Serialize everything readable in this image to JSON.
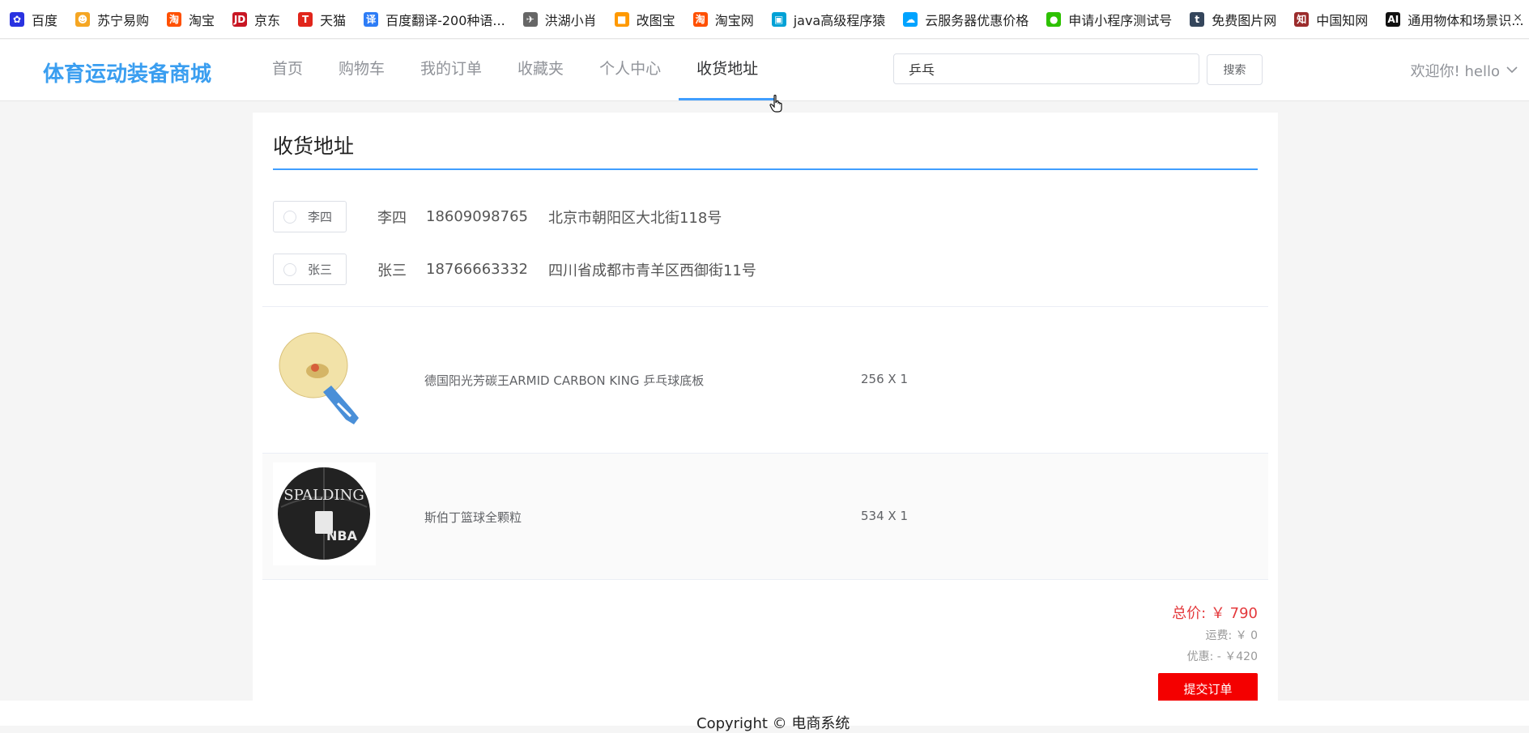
{
  "bookmarks": [
    {
      "label": "百度",
      "icon": "baidu-paw-icon",
      "color": "#2932e1",
      "glyph": "✿"
    },
    {
      "label": "苏宁易购",
      "icon": "suning-icon",
      "color": "#f5a623",
      "glyph": "☻"
    },
    {
      "label": "淘宝",
      "icon": "taobao-icon",
      "color": "#ff5000",
      "glyph": "淘"
    },
    {
      "label": "京东",
      "icon": "jd-icon",
      "color": "#c81623",
      "glyph": "JD"
    },
    {
      "label": "天猫",
      "icon": "tmall-icon",
      "color": "#e1251b",
      "glyph": "T"
    },
    {
      "label": "百度翻译-200种语...",
      "icon": "baidu-translate-icon",
      "color": "#2d7cf6",
      "glyph": "译"
    },
    {
      "label": "洪湖小肖",
      "icon": "bird-icon",
      "color": "#666666",
      "glyph": "✈"
    },
    {
      "label": "改图宝",
      "icon": "gaitubao-icon",
      "color": "#ff9900",
      "glyph": "■"
    },
    {
      "label": "淘宝网",
      "icon": "taobao-net-icon",
      "color": "#ff5000",
      "glyph": "淘"
    },
    {
      "label": "java高级程序猿",
      "icon": "bilibili-icon",
      "color": "#00a1d6",
      "glyph": "▣"
    },
    {
      "label": "云服务器优惠价格",
      "icon": "cloud-icon",
      "color": "#00a3ff",
      "glyph": "☁"
    },
    {
      "label": "申请小程序测试号",
      "icon": "wechat-icon",
      "color": "#2dc100",
      "glyph": "●"
    },
    {
      "label": "免费图片网",
      "icon": "tumblr-icon",
      "color": "#35465c",
      "glyph": "t"
    },
    {
      "label": "中国知网",
      "icon": "cnki-icon",
      "color": "#9b2c2c",
      "glyph": "知"
    },
    {
      "label": "通用物体和场景识...",
      "icon": "ai-icon",
      "color": "#111111",
      "glyph": "AI"
    }
  ],
  "header": {
    "logo": "体育运动装备商城",
    "nav": [
      {
        "label": "首页",
        "active": false
      },
      {
        "label": "购物车",
        "active": false
      },
      {
        "label": "我的订单",
        "active": false
      },
      {
        "label": "收藏夹",
        "active": false
      },
      {
        "label": "个人中心",
        "active": false
      },
      {
        "label": "收货地址",
        "active": true
      }
    ],
    "search_value": "乒乓",
    "search_button": "搜索",
    "welcome": "欢迎你!  hello"
  },
  "address_section": {
    "title": "收货地址",
    "addresses": [
      {
        "radio_label": "李四",
        "name": "李四",
        "phone": "18609098765",
        "address": "北京市朝阳区大北街118号"
      },
      {
        "radio_label": "张三",
        "name": "张三",
        "phone": "18766663332",
        "address": "四川省成都市青羊区西御街11号"
      }
    ]
  },
  "products": [
    {
      "name": "德国阳光芳碳王ARMID CARBON KING 乒乓球底板",
      "qty": "256 X 1",
      "image": "pingpong-paddle"
    },
    {
      "name": "斯伯丁篮球全颗粒",
      "qty": "534 X 1",
      "image": "spalding-basketball"
    }
  ],
  "summary": {
    "total": "总价: ￥ 790",
    "shipping": "运费: ￥ 0",
    "discount": "优惠: - ￥420",
    "submit": "提交订单"
  },
  "footer": {
    "copyright": "Copyright © 电商系统"
  }
}
